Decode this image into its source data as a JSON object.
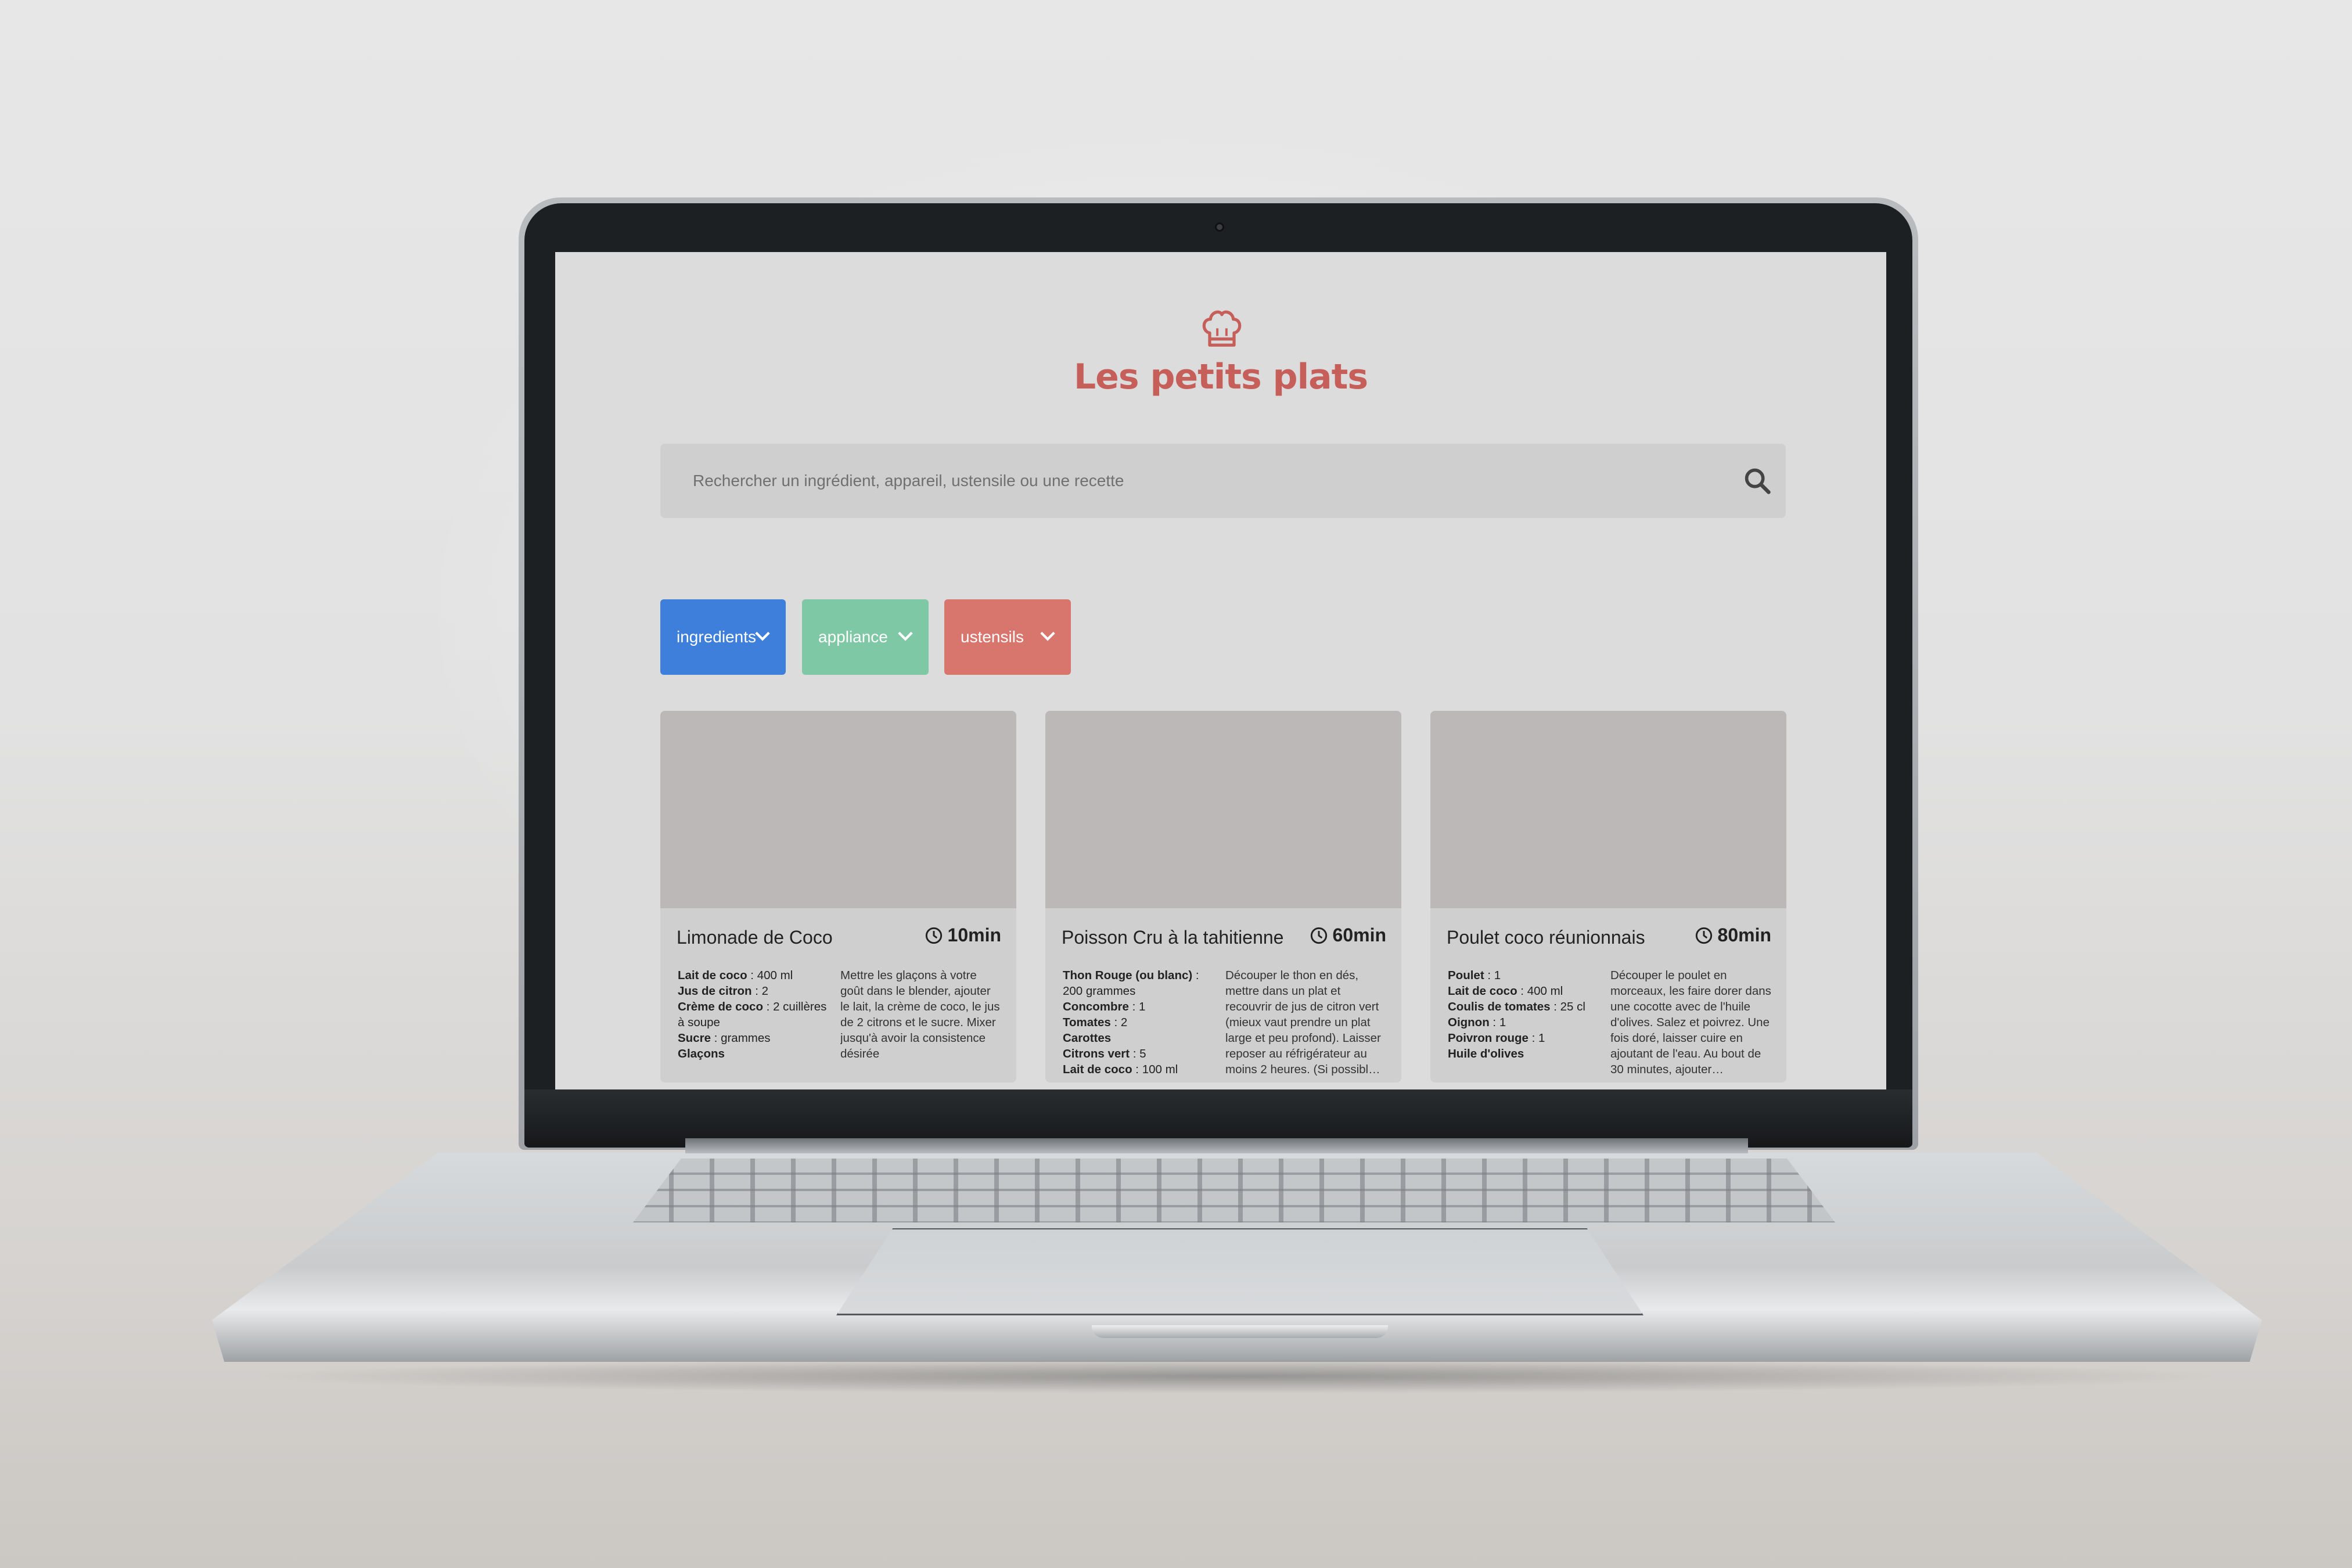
{
  "site": {
    "title": "Les petits plats",
    "logo_icon": "chef-hat-icon",
    "brand_color": "#c65f59"
  },
  "search": {
    "placeholder": "Rechercher un ingrédient, appareil, ustensile ou une recette",
    "icon": "search-icon"
  },
  "filters": [
    {
      "label": "ingredients",
      "color": "#3f7fdc",
      "icon": "chevron-down-icon"
    },
    {
      "label": "appliance",
      "color": "#7ec8a6",
      "icon": "chevron-down-icon"
    },
    {
      "label": "ustensils",
      "color": "#d8766d",
      "icon": "chevron-down-icon"
    }
  ],
  "recipes": [
    {
      "name": "Limonade de Coco",
      "time": "10min",
      "ingredients": [
        {
          "name": "Lait de coco",
          "qty": " : 400 ml"
        },
        {
          "name": "Jus de citron",
          "qty": " : 2"
        },
        {
          "name": "Crème de coco",
          "qty": " : 2 cuillères à soupe"
        },
        {
          "name": "Sucre",
          "qty": " : grammes"
        },
        {
          "name": "Glaçons",
          "qty": ""
        }
      ],
      "description": "Mettre les glaçons à votre goût dans le blender, ajouter le lait, la crème de coco, le jus de 2 citrons et le sucre. Mixer jusqu'à avoir la consistence désirée"
    },
    {
      "name": "Poisson Cru à la tahitienne",
      "time": "60min",
      "ingredients": [
        {
          "name": "Thon Rouge (ou blanc)",
          "qty": " : 200 grammes"
        },
        {
          "name": "Concombre",
          "qty": " : 1"
        },
        {
          "name": "Tomates",
          "qty": " : 2"
        },
        {
          "name": "Carottes",
          "qty": ""
        },
        {
          "name": "Citrons vert",
          "qty": " : 5"
        },
        {
          "name": "Lait de coco",
          "qty": " : 100 ml"
        }
      ],
      "description": "Découper le thon en dés, mettre dans un plat et recouvrir de jus de citron vert (mieux vaut prendre un plat large et peu profond). Laisser reposer au réfrigérateur au moins 2 heures. (Si possibl…"
    },
    {
      "name": "Poulet coco réunionnais",
      "time": "80min",
      "ingredients": [
        {
          "name": "Poulet",
          "qty": " : 1"
        },
        {
          "name": "Lait de coco",
          "qty": " : 400 ml"
        },
        {
          "name": "Coulis de tomates",
          "qty": " : 25 cl"
        },
        {
          "name": "Oignon",
          "qty": " : 1"
        },
        {
          "name": "Poivron rouge",
          "qty": " : 1"
        },
        {
          "name": "Huile d'olives",
          "qty": ""
        }
      ],
      "description": "Découper le poulet en morceaux, les faire dorer dans une cocotte avec de l'huile d'olives. Salez et poivrez. Une fois doré, laisser cuire en ajoutant de l'eau. Au bout de 30 minutes, ajouter…"
    }
  ]
}
